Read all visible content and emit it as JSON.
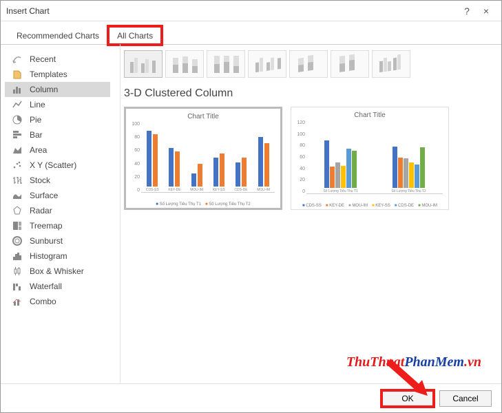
{
  "title": "Insert Chart",
  "help_glyph": "?",
  "close_glyph": "×",
  "tabs": [
    {
      "label": "Recommended Charts",
      "active": false
    },
    {
      "label": "All Charts",
      "active": true
    }
  ],
  "sidebar": {
    "items": [
      {
        "label": "Recent"
      },
      {
        "label": "Templates"
      },
      {
        "label": "Column"
      },
      {
        "label": "Line"
      },
      {
        "label": "Pie"
      },
      {
        "label": "Bar"
      },
      {
        "label": "Area"
      },
      {
        "label": "X Y (Scatter)"
      },
      {
        "label": "Stock"
      },
      {
        "label": "Surface"
      },
      {
        "label": "Radar"
      },
      {
        "label": "Treemap"
      },
      {
        "label": "Sunburst"
      },
      {
        "label": "Histogram"
      },
      {
        "label": "Box & Whisker"
      },
      {
        "label": "Waterfall"
      },
      {
        "label": "Combo"
      }
    ],
    "selected_index": 2
  },
  "section_title": "3-D Clustered Column",
  "buttons": {
    "ok": "OK",
    "cancel": "Cancel"
  },
  "watermark": {
    "part1": "ThuThuat",
    "part2": "PhanMem",
    "part3": ".vn"
  },
  "chart_data": [
    {
      "type": "bar",
      "title": "Chart Title",
      "ylim": [
        0,
        100
      ],
      "yticks": [
        0,
        20,
        40,
        60,
        80,
        100
      ],
      "categories": [
        "CDS-SS",
        "KEY-DE",
        "MOU-IM",
        "KEY-SS",
        "CDS-DE",
        "MOU-IM"
      ],
      "series": [
        {
          "name": "Số Lượng Tiêu Thụ T1",
          "values": [
            92,
            64,
            22,
            48,
            40,
            82
          ]
        },
        {
          "name": "Số Lượng Tiêu Thụ T2",
          "values": [
            86,
            58,
            38,
            54,
            48,
            72
          ]
        }
      ]
    },
    {
      "type": "bar",
      "title": "Chart Title",
      "ylim": [
        0,
        120
      ],
      "yticks": [
        0,
        20,
        40,
        60,
        80,
        100,
        120
      ],
      "categories": [
        "Số Lượng Tiêu Thụ T1",
        "Số Lượng Tiêu Thụ T2"
      ],
      "series": [
        {
          "name": "CDS-SS",
          "values": [
            94,
            82
          ]
        },
        {
          "name": "KEY-DE",
          "values": [
            42,
            60
          ]
        },
        {
          "name": "MOU-IM",
          "values": [
            50,
            58
          ]
        },
        {
          "name": "KEY-SS",
          "values": [
            44,
            50
          ]
        },
        {
          "name": "CDS-DE",
          "values": [
            78,
            46
          ]
        },
        {
          "name": "MOU-IM",
          "values": [
            74,
            80
          ]
        }
      ]
    }
  ]
}
